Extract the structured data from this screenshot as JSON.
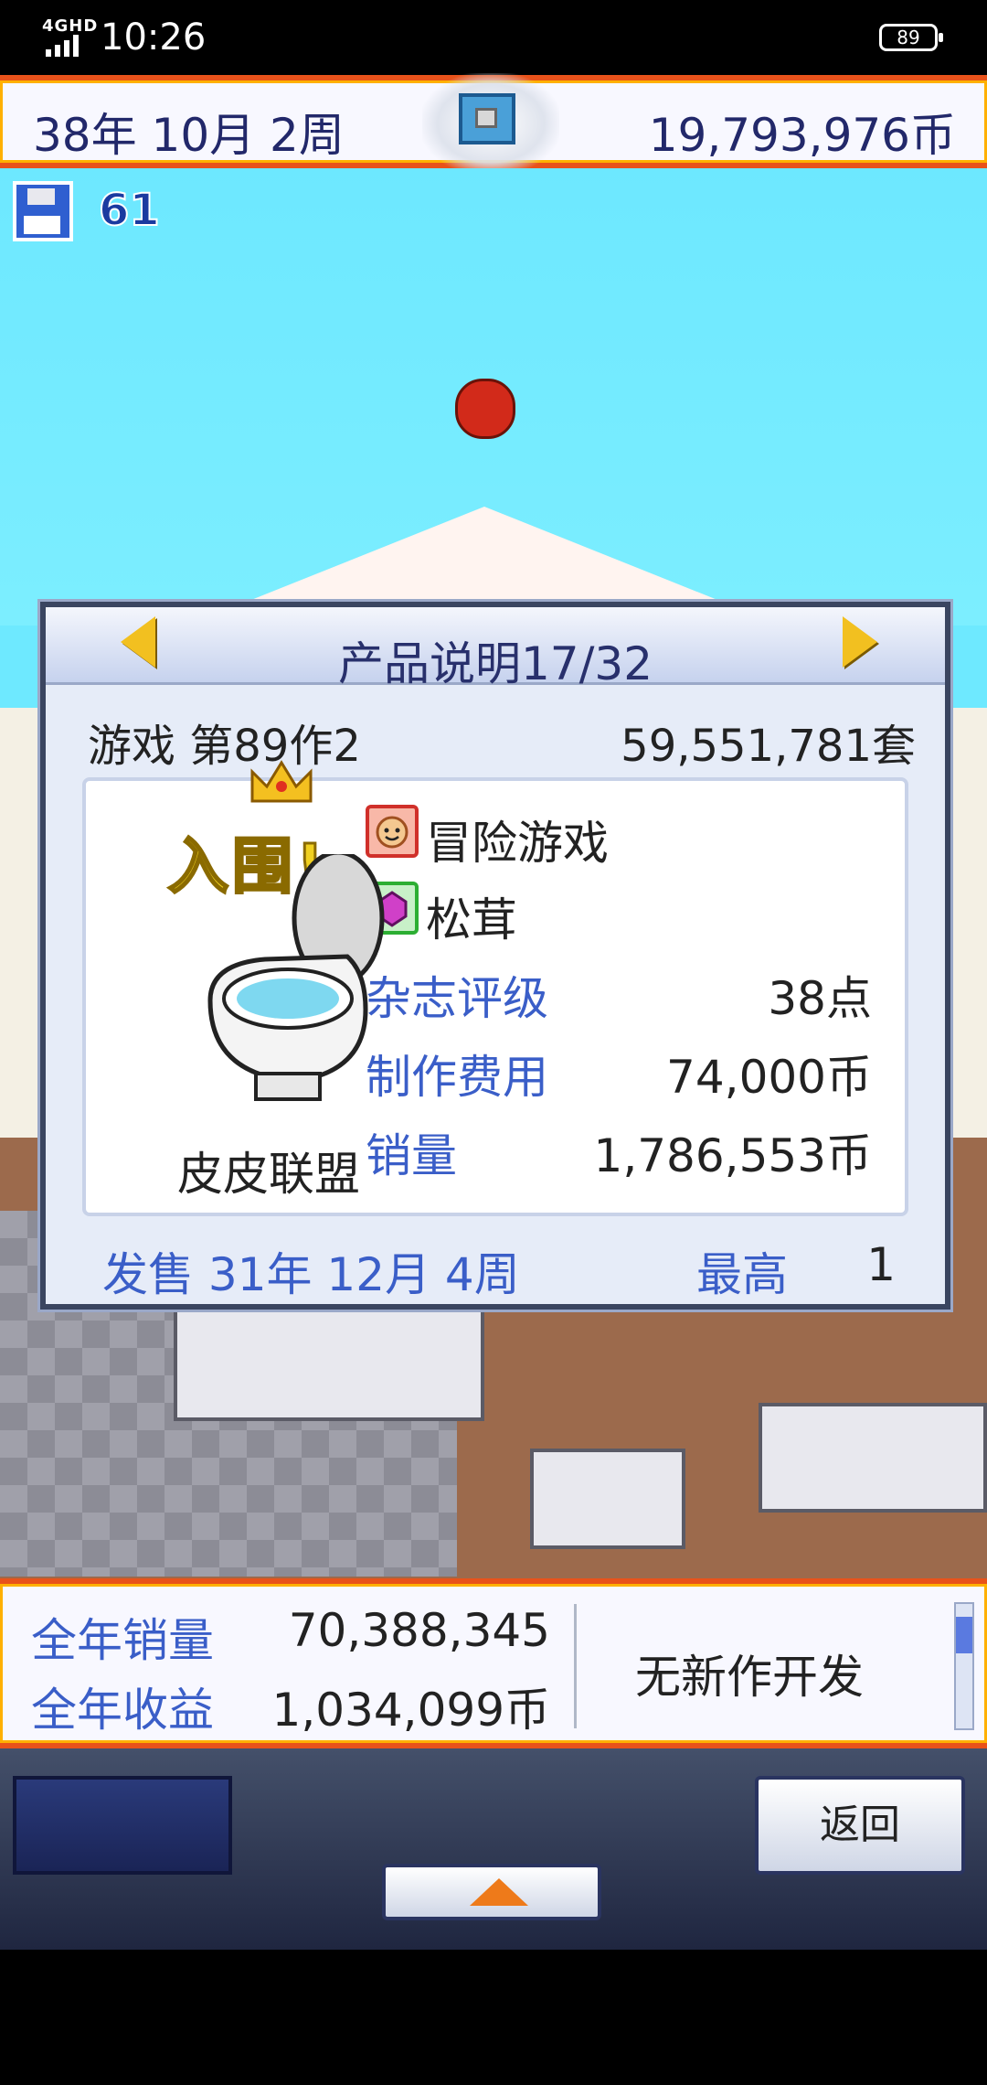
{
  "status_bar": {
    "network": "4GHD",
    "time": "10:26",
    "battery": "89"
  },
  "top_bar": {
    "date": "38年 10月 2周",
    "money": "19,793,976币",
    "save_count": "61"
  },
  "dialog": {
    "title": "产品说明17/32",
    "game_number": "游戏 第89作2",
    "units_sold": "59,551,781套",
    "badge": "入围!",
    "game_title": "皮皮联盟",
    "genre": "冒险游戏",
    "theme": "松茸",
    "magazine_label": "杂志评级",
    "magazine_value": "38点",
    "cost_label": "制作费用",
    "cost_value": "74,000币",
    "sales_label": "销量",
    "sales_value": "1,786,553币",
    "release": "发售 31年 12月 4周",
    "best_label": "最高",
    "best_value": "1"
  },
  "stats": {
    "annual_sales_label": "全年销量",
    "annual_sales_value": "70,388,345",
    "annual_revenue_label": "全年收益",
    "annual_revenue_value": "1,034,099币",
    "dev_status": "无新作开发"
  },
  "controls": {
    "back_label": "返回"
  }
}
